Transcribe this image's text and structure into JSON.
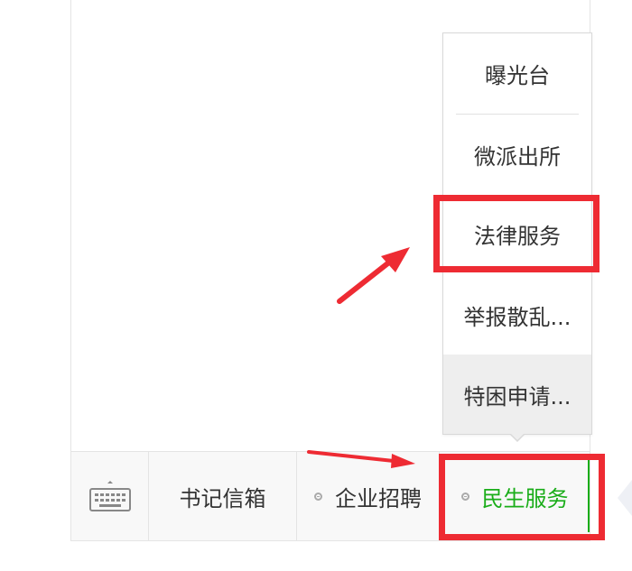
{
  "submenu": {
    "items": [
      {
        "label": "曝光台"
      },
      {
        "label": "微派出所"
      },
      {
        "label": "法律服务"
      },
      {
        "label": "举报散乱..."
      },
      {
        "label": "特困申请..."
      }
    ]
  },
  "menubar": {
    "keyboard_icon": "keyboard-icon",
    "items": [
      {
        "label": "书记信箱"
      },
      {
        "label": "企业招聘"
      },
      {
        "label": "民生服务"
      }
    ]
  },
  "colors": {
    "annotation_red": "#ee2b33",
    "active_green": "#1aad19",
    "text": "#333333",
    "border": "#e4e4e4"
  }
}
